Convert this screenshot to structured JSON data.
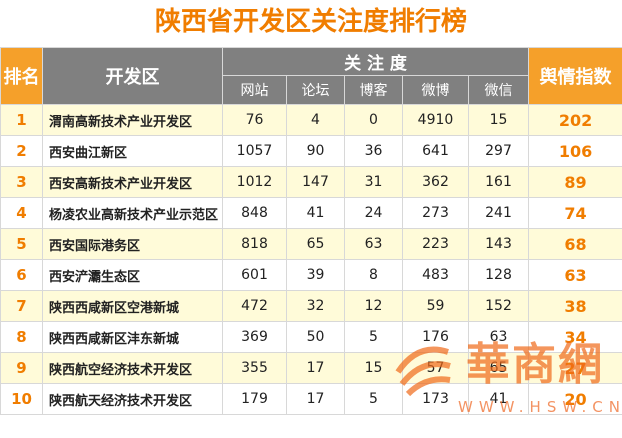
{
  "title": "陕西省开发区关注度排行榜",
  "header": {
    "rank": "排名",
    "zone": "开发区",
    "attention": "关 注 度",
    "cols": [
      "网站",
      "论坛",
      "博客",
      "微博",
      "微信"
    ],
    "index": "舆情指数"
  },
  "colors": {
    "accent": "#f07d00",
    "header_gray": "#808080",
    "header_orange": "#f5a02a",
    "row_alt": "#fffbd9"
  },
  "chart_data": {
    "type": "table",
    "title": "陕西省开发区关注度排行榜",
    "columns": [
      "排名",
      "开发区",
      "网站",
      "论坛",
      "博客",
      "微博",
      "微信",
      "舆情指数"
    ],
    "rows": [
      [
        "1",
        "渭南高新技术产业开发区",
        "76",
        "4",
        "0",
        "4910",
        "15",
        "202"
      ],
      [
        "2",
        "西安曲江新区",
        "1057",
        "90",
        "36",
        "641",
        "297",
        "106"
      ],
      [
        "3",
        "西安高新技术产业开发区",
        "1012",
        "147",
        "31",
        "362",
        "161",
        "89"
      ],
      [
        "4",
        "杨凌农业高新技术产业示范区",
        "848",
        "41",
        "24",
        "273",
        "241",
        "74"
      ],
      [
        "5",
        "西安国际港务区",
        "818",
        "65",
        "63",
        "223",
        "143",
        "68"
      ],
      [
        "6",
        "西安浐灞生态区",
        "601",
        "39",
        "8",
        "483",
        "128",
        "63"
      ],
      [
        "7",
        "陕西西咸新区空港新城",
        "472",
        "32",
        "12",
        "59",
        "152",
        "38"
      ],
      [
        "8",
        "陕西西咸新区沣东新城",
        "369",
        "50",
        "5",
        "176",
        "63",
        "34"
      ],
      [
        "9",
        "陕西航空经济技术开发区",
        "355",
        "17",
        "15",
        "57",
        "65",
        "27"
      ],
      [
        "10",
        "陕西航天经济技术开发区",
        "179",
        "17",
        "5",
        "173",
        "41",
        "20"
      ]
    ]
  },
  "watermark": {
    "brand": "華商網",
    "url": "WWW.HSW.CN",
    "logo_icon": "hsw-logo-icon"
  }
}
